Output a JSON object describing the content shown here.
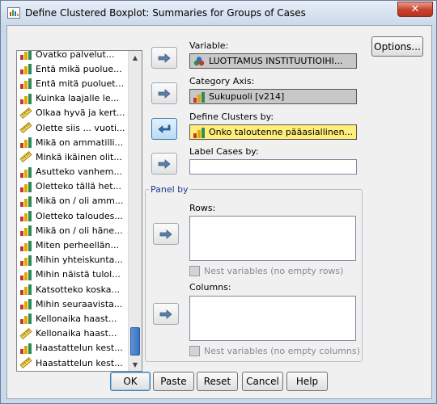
{
  "window": {
    "title": "Define Clustered Boxplot: Summaries for Groups of Cases",
    "close_symbol": "✕"
  },
  "variable_list": {
    "items": [
      {
        "label": "Ovatko palvelut...",
        "icon": "ordinal-bar-icon"
      },
      {
        "label": "Entä mikä puoluе...",
        "icon": "ordinal-bar-icon"
      },
      {
        "label": "Entä mitä puoluet...",
        "icon": "ordinal-bar-icon"
      },
      {
        "label": "Kuinka laajalle le...",
        "icon": "ordinal-bar-icon"
      },
      {
        "label": "Olkaa hyvä ja kert...",
        "icon": "scale-ruler-icon"
      },
      {
        "label": "Olette siis ... vuoti...",
        "icon": "scale-ruler-icon"
      },
      {
        "label": "Mikä on ammatilli...",
        "icon": "ordinal-bar-icon"
      },
      {
        "label": "Minkä ikäinen olit...",
        "icon": "scale-ruler-icon"
      },
      {
        "label": "Asutteko vanhem...",
        "icon": "ordinal-bar-icon"
      },
      {
        "label": "Oletteko tällä het...",
        "icon": "ordinal-bar-icon"
      },
      {
        "label": "Mikä on / oli amm...",
        "icon": "ordinal-bar-icon"
      },
      {
        "label": "Oletteko taloudes...",
        "icon": "ordinal-bar-icon"
      },
      {
        "label": "Mikä on / oli hänе...",
        "icon": "ordinal-bar-icon"
      },
      {
        "label": "Miten perheellän...",
        "icon": "ordinal-bar-icon"
      },
      {
        "label": "Mihin yhteiskunta...",
        "icon": "ordinal-bar-icon"
      },
      {
        "label": "Mihin näistä tulol...",
        "icon": "ordinal-bar-icon"
      },
      {
        "label": "Katsotteko koska...",
        "icon": "ordinal-bar-icon"
      },
      {
        "label": "Mihin seuraavista...",
        "icon": "ordinal-bar-icon"
      },
      {
        "label": "Kellonaika haast...",
        "icon": "ordinal-bar-icon"
      },
      {
        "label": "Kellonaika haast...",
        "icon": "scale-ruler-icon"
      },
      {
        "label": "Haastattelun kest...",
        "icon": "ordinal-bar-icon"
      },
      {
        "label": "Haastattelun kest...",
        "icon": "scale-ruler-icon"
      }
    ]
  },
  "variable": {
    "label": "Variable:",
    "value": "LUOTTAMUS INSTITUUTIOIHI..."
  },
  "category_axis": {
    "label": "Category Axis:",
    "value": "Sukupuoli [v214]"
  },
  "define_clusters": {
    "label": "Define Clusters by:",
    "value": "Onko taloutenne pääasiallinen..."
  },
  "label_cases": {
    "label": "Label Cases by:",
    "value": ""
  },
  "panel_by": {
    "legend": "Panel by",
    "rows_label": "Rows:",
    "nest_rows_label": "Nest variables (no empty rows)",
    "columns_label": "Columns:",
    "nest_columns_label": "Nest variables (no empty columns)"
  },
  "buttons": {
    "options": "Options...",
    "ok": "OK",
    "paste": "Paste",
    "reset": "Reset",
    "cancel": "Cancel",
    "help": "Help"
  }
}
